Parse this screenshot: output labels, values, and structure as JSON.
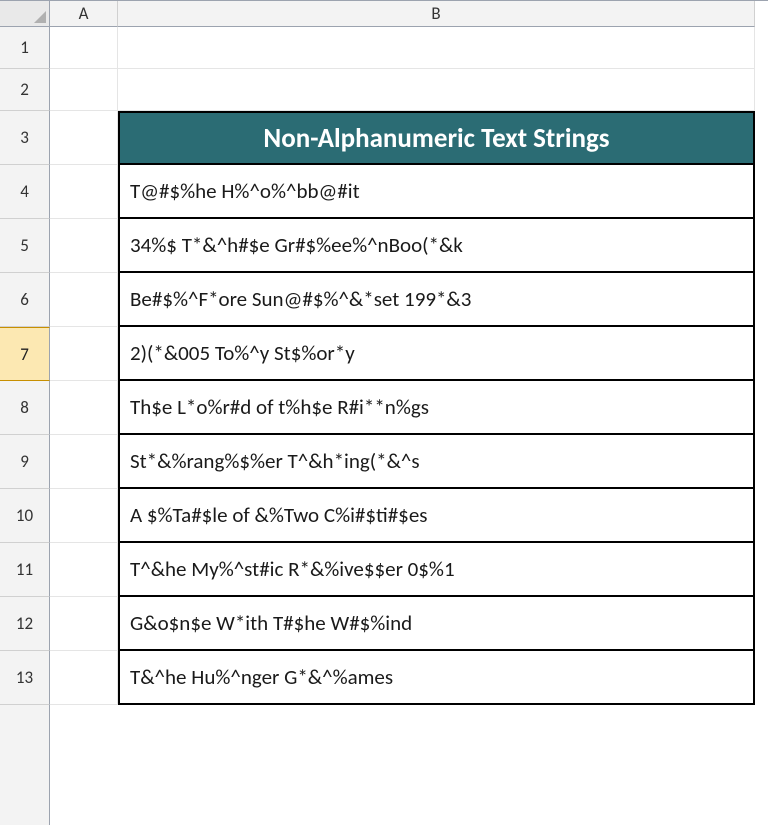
{
  "columns": {
    "A": "A",
    "B": "B"
  },
  "rows": [
    "1",
    "2",
    "3",
    "4",
    "5",
    "6",
    "7",
    "8",
    "9",
    "10",
    "11",
    "12",
    "13"
  ],
  "active_row": "7",
  "table": {
    "header": "Non-Alphanumeric Text Strings",
    "data": [
      "T@#$%he H%^o%^bb@#it",
      "34%$ T*&^h#$e Gr#$%ee%^nBoo(*&k",
      "Be#$%^F*ore Sun@#$%^&*set 199*&3",
      "2)(*&005 To%^y St$%or*y",
      "Th$e L*o%r#d of t%h$e R#i**n%gs",
      "St*&%rang%$%er T^&h*ing(*&^s",
      "A $%Ta#$le of &%Two C%i#$ti#$es",
      "T^&he My%^st#ic R*&%ive$$er 0$%1",
      "G&o$n$e W*ith T#$he W#$%ind",
      "T&^he Hu%^nger G*&^%ames"
    ]
  }
}
